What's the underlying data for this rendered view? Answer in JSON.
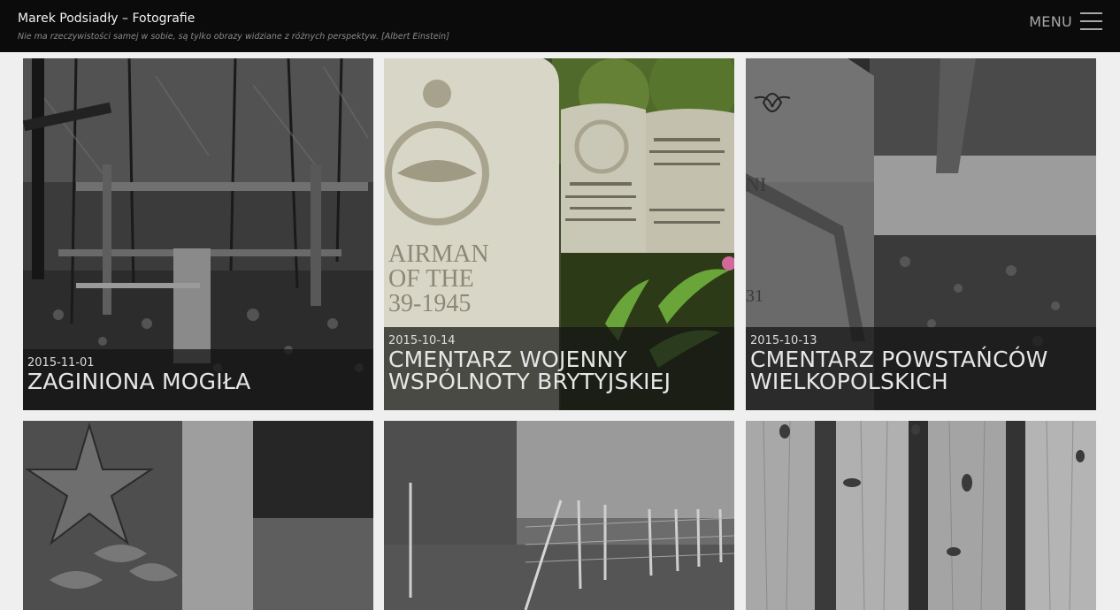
{
  "header": {
    "site_title": "Marek Podsiadły – Fotografie",
    "motto": "Nie ma rzeczywistości samej w sobie, są tylko obrazy widziane z różnych perspektyw. [Albert Einstein]",
    "menu_label": "MENU"
  },
  "posts": [
    {
      "date": "2015-11-01",
      "title": "Zaginiona mogiła"
    },
    {
      "date": "2015-10-14",
      "title": "Cmentarz Wojenny Wspólnoty Brytyjskiej"
    },
    {
      "date": "2015-10-13",
      "title": "Cmentarz Powstańców Wielkopolskich"
    }
  ],
  "colors": {
    "header_bg": "#0b0b0b",
    "page_bg": "#efefef",
    "caption_bg": "rgba(20,20,20,0.72)"
  }
}
